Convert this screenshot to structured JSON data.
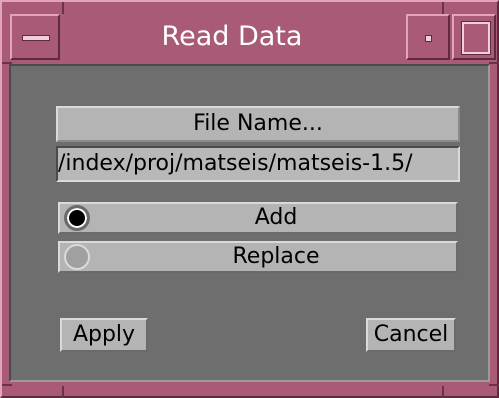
{
  "window": {
    "title": "Read Data"
  },
  "dialog": {
    "file_button_label": "File Name...",
    "file_path": "/index/proj/matseis/matseis-1.5/",
    "options": [
      {
        "label": "Add",
        "selected": true
      },
      {
        "label": "Replace",
        "selected": false
      }
    ],
    "apply_label": "Apply",
    "cancel_label": "Cancel"
  },
  "colors": {
    "frame": "#a85a76",
    "panel": "#6e6e6e",
    "button": "#b4b4b4",
    "title_text": "#ffffff"
  }
}
